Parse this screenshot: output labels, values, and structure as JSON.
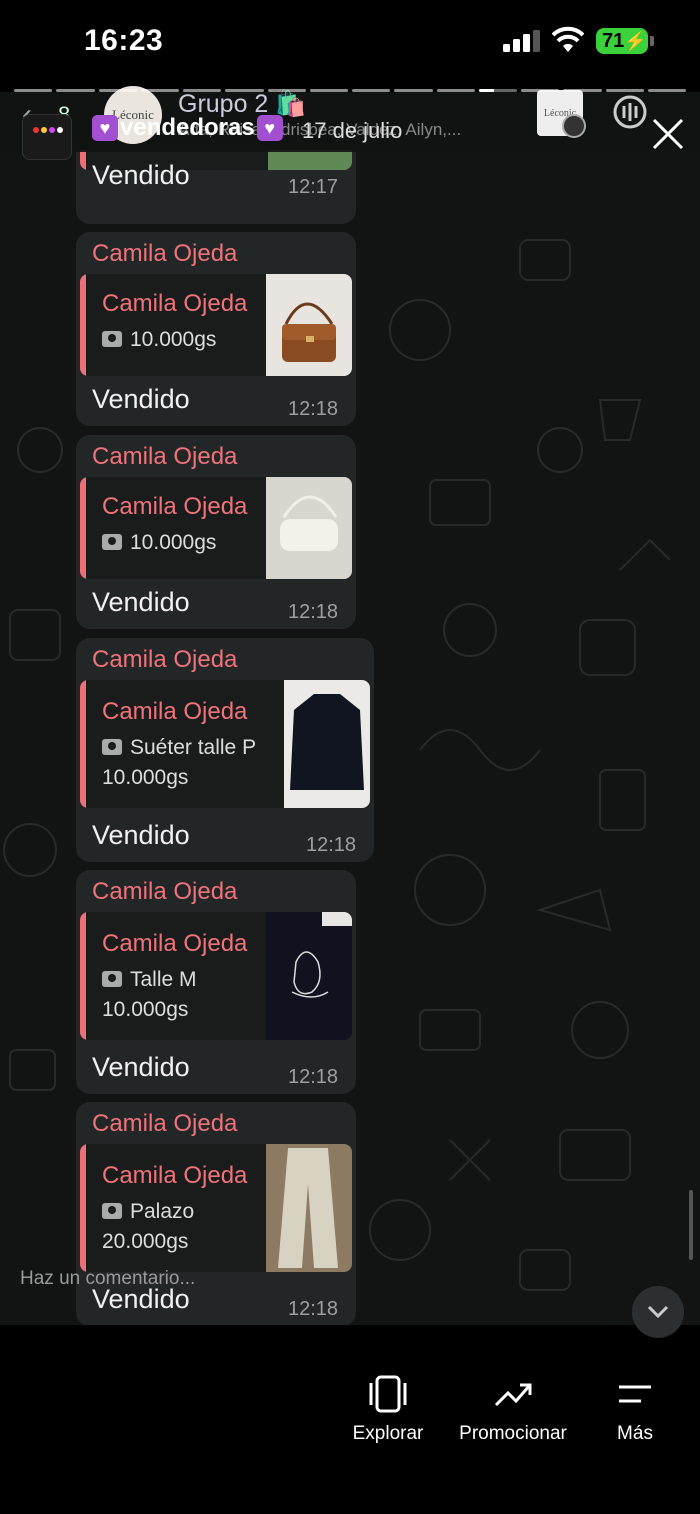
{
  "status_bar": {
    "time": "16:23",
    "battery": "71"
  },
  "chat_header": {
    "back_count": "8",
    "group_avatar_text": "Léconic",
    "group_name": "Grupo 2 🛍️",
    "members": "Ada, Raisa, Adrisbea, Valdez, Ailyn,..."
  },
  "story": {
    "username": "vendedoras",
    "date": "17 de julio"
  },
  "messages": [
    {
      "sender": "",
      "quote_name": "",
      "quote_lines": [],
      "text": "Vendido",
      "time": "12:17",
      "thumb": "green-bag"
    },
    {
      "sender": "Camila Ojeda",
      "quote_name": "Camila Ojeda",
      "quote_lines": [
        "10.000gs"
      ],
      "text": "Vendido",
      "time": "12:18",
      "thumb": "brown-bag"
    },
    {
      "sender": "Camila Ojeda",
      "quote_name": "Camila Ojeda",
      "quote_lines": [
        "10.000gs"
      ],
      "text": "Vendido",
      "time": "12:18",
      "thumb": "white-bag"
    },
    {
      "sender": "Camila Ojeda",
      "quote_name": "Camila Ojeda",
      "quote_lines": [
        "Suéter talle P",
        "10.000gs"
      ],
      "text": "Vendido",
      "time": "12:18",
      "thumb": "black-sweater"
    },
    {
      "sender": "Camila Ojeda",
      "quote_name": "Camila Ojeda",
      "quote_lines": [
        "Talle M",
        "10.000gs"
      ],
      "text": "Vendido",
      "time": "12:18",
      "thumb": "printed-sweater"
    },
    {
      "sender": "Camila Ojeda",
      "quote_name": "Camila Ojeda",
      "quote_lines": [
        "Palazo",
        "20.000gs"
      ],
      "text": "Vendido",
      "time": "12:18",
      "thumb": "palazzo-pants"
    }
  ],
  "comment_placeholder": "Haz un comentario...",
  "bottom_nav": [
    {
      "label": "Explorar",
      "icon": "explore-icon"
    },
    {
      "label": "Promocionar",
      "icon": "trend-up-icon"
    },
    {
      "label": "Más",
      "icon": "menu-icon"
    }
  ],
  "colors": {
    "sender_name": "#f0727b",
    "quote_bar": "#ef6f79",
    "bubble": "#232626",
    "chat_bg": "#121313",
    "battery": "#3ad13a"
  }
}
